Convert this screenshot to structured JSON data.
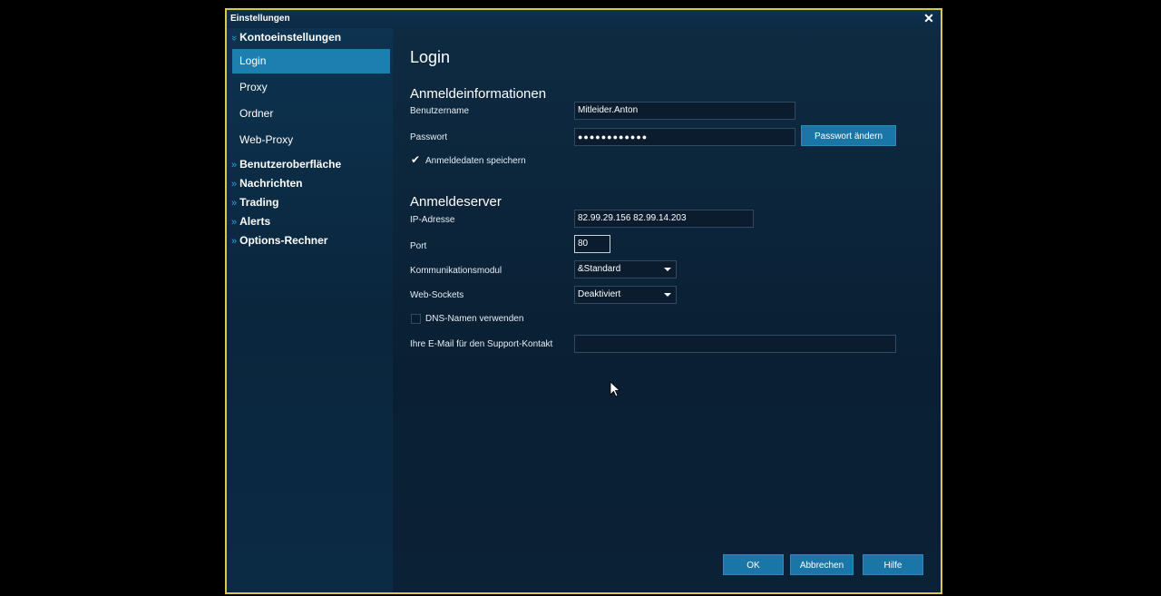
{
  "window": {
    "title": "Einstellungen",
    "close": "✕"
  },
  "sidebar": {
    "section_open": {
      "label": "Kontoeinstellungen",
      "chevron": "»"
    },
    "items": [
      {
        "label": "Login",
        "selected": true
      },
      {
        "label": "Proxy",
        "selected": false
      },
      {
        "label": "Ordner",
        "selected": false
      },
      {
        "label": "Web-Proxy",
        "selected": false
      }
    ],
    "categories": [
      {
        "label": "Benutzeroberfläche",
        "chevron": "»"
      },
      {
        "label": "Nachrichten",
        "chevron": "»"
      },
      {
        "label": "Trading",
        "chevron": "»"
      },
      {
        "label": "Alerts",
        "chevron": "»"
      },
      {
        "label": "Options-Rechner",
        "chevron": "»"
      }
    ]
  },
  "page": {
    "title": "Login",
    "login_section": {
      "heading": "Anmeldeinformationen",
      "username_label": "Benutzername",
      "username_value": "Mitleider.Anton",
      "password_label": "Passwort",
      "password_value": "●●●●●●●●●●●●",
      "change_password_button": "Passwort ändern",
      "save_credentials_label": "Anmeldedaten speichern",
      "save_credentials_checked": true
    },
    "server_section": {
      "heading": "Anmeldeserver",
      "ip_label": "IP-Adresse",
      "ip_value": "82.99.29.156 82.99.14.203",
      "port_label": "Port",
      "port_value": "80",
      "comm_label": "Kommunikationsmodul",
      "comm_value": "&Standard",
      "websockets_label": "Web-Sockets",
      "websockets_value": "Deaktiviert",
      "dns_label": "DNS-Namen verwenden",
      "dns_checked": false,
      "email_label": "Ihre E-Mail für den Support-Kontakt",
      "email_value": ""
    }
  },
  "footer": {
    "ok": "OK",
    "cancel": "Abbrechen",
    "help": "Hilfe"
  },
  "colors": {
    "accent": "#1c7fb0",
    "border": "#d8c94a",
    "background": "#0b2236"
  }
}
